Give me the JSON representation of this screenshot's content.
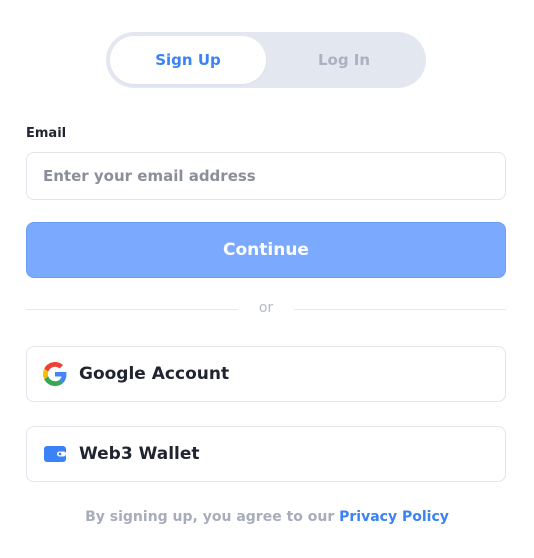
{
  "tabs": {
    "items": [
      {
        "label": "Sign Up",
        "active": true
      },
      {
        "label": "Log In",
        "active": false
      }
    ]
  },
  "email": {
    "label": "Email",
    "placeholder": "Enter your email address",
    "value": ""
  },
  "continue_label": "Continue",
  "divider_text": "or",
  "social": {
    "google": {
      "label": "Google Account",
      "icon": "google-icon"
    },
    "wallet": {
      "label": "Web3 Wallet",
      "icon": "wallet-icon"
    }
  },
  "footer": {
    "text": "By signing up, you agree to our",
    "link": "Privacy Policy"
  },
  "colors": {
    "accent": "#3b82f6",
    "continue_bg": "#7ba9fd",
    "tab_track": "#e3e7f0"
  }
}
